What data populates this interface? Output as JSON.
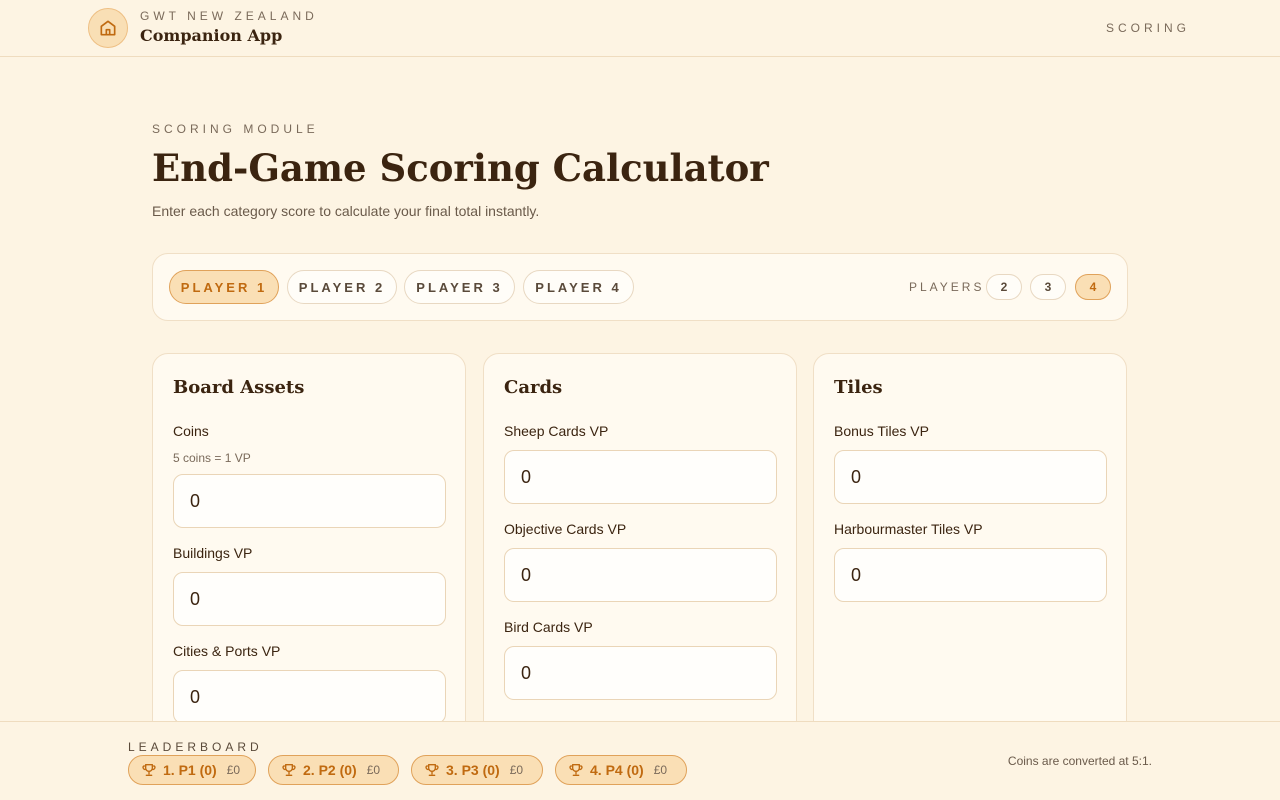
{
  "header": {
    "brand_top": "GWT NEW ZEALAND",
    "brand_main": "Companion App",
    "nav_scoring": "SCORING",
    "home_icon": "house-icon"
  },
  "intro": {
    "eyebrow": "SCORING MODULE",
    "title": "End-Game Scoring Calculator",
    "subtitle": "Enter each category score to calculate your final total instantly."
  },
  "players": {
    "tabs": [
      "PLAYER 1",
      "PLAYER 2",
      "PLAYER 3",
      "PLAYER 4"
    ],
    "active_tab": 0,
    "count_label": "PLAYERS",
    "counts": [
      "2",
      "3",
      "4"
    ],
    "active_count": "4"
  },
  "cards": {
    "board": {
      "title": "Board Assets",
      "coins_label": "Coins",
      "coins_hint": "5 coins = 1 VP",
      "coins_value": "0",
      "buildings_label": "Buildings VP",
      "buildings_value": "0",
      "cities_label": "Cities & Ports VP",
      "cities_value": "0"
    },
    "cards": {
      "title": "Cards",
      "sheep_label": "Sheep Cards VP",
      "sheep_value": "0",
      "objective_label": "Objective Cards VP",
      "objective_value": "0",
      "bird_label": "Bird Cards VP",
      "bird_value": "0"
    },
    "tiles": {
      "title": "Tiles",
      "bonus_label": "Bonus Tiles VP",
      "bonus_value": "0",
      "harbour_label": "Harbourmaster Tiles VP",
      "harbour_value": "0"
    }
  },
  "leaderboard": {
    "label": "LEADERBOARD",
    "entries": [
      {
        "text": "1. P1 (0)",
        "money": "£0"
      },
      {
        "text": "2. P2 (0)",
        "money": "£0"
      },
      {
        "text": "3. P3 (0)",
        "money": "£0"
      },
      {
        "text": "4. P4 (0)",
        "money": "£0"
      }
    ],
    "footnote": "Coins are converted at 5:1."
  },
  "colors": {
    "background": "#fdf4e3",
    "accent": "#c06a10",
    "accent_fill": "#fadfb5",
    "text": "#3b2410"
  }
}
